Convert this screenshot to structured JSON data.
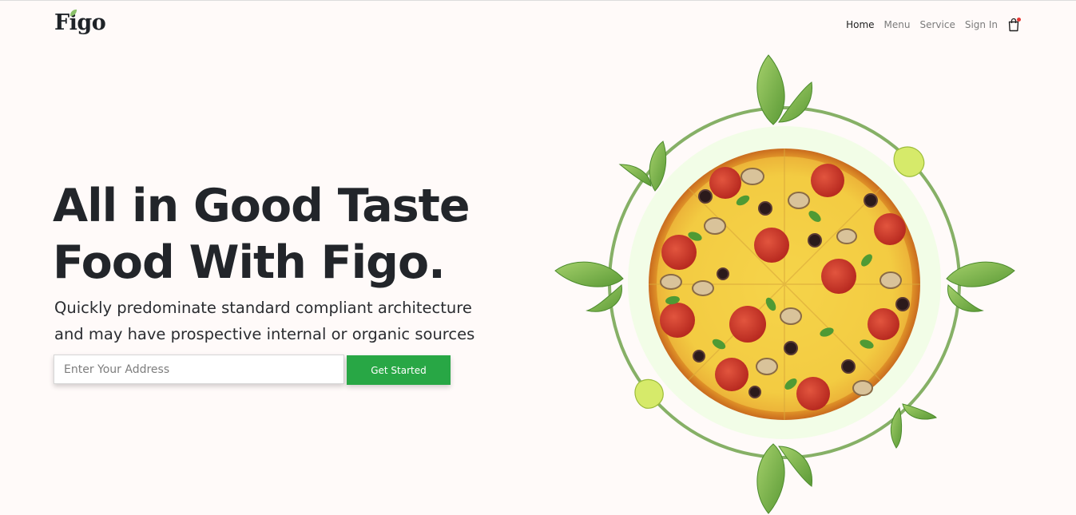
{
  "header": {
    "logo": "Figo",
    "nav": [
      "Home",
      "Menu",
      "Service",
      "Sign In"
    ],
    "cart_icon": "shopping-bag-icon"
  },
  "hero": {
    "title_line1": "All in Good Taste",
    "title_line2": "Food With Figo.",
    "subtitle_line1": "Quickly predominate standard compliant architecture",
    "subtitle_line2": "and may have prospective internal or organic sources",
    "address_placeholder": "Enter Your Address",
    "cta_label": "Get Started"
  },
  "colors": {
    "accent": "#28a745",
    "background": "#fffaf9",
    "ring": "#86b066",
    "cart_badge": "#e53935"
  },
  "illustration": {
    "image": "pepperoni-pizza-image",
    "decoration": "basil-leaves"
  }
}
